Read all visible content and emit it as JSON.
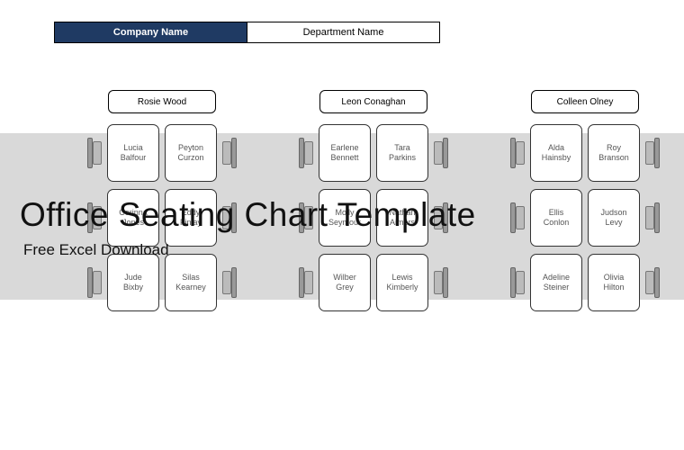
{
  "header": {
    "company": "Company Name",
    "department": "Department Name"
  },
  "overlay": {
    "title": "Office Seating Chart Template",
    "subtitle": "Free Excel Download"
  },
  "clusters": [
    {
      "manager": "Rosie Wood",
      "rows": [
        {
          "left": "Lucia Balfour",
          "right": "Peyton Curzon"
        },
        {
          "left": "Corinna Jones",
          "right": "Eddy Finlay"
        },
        {
          "left": "Jude Bixby",
          "right": "Silas Kearney"
        }
      ]
    },
    {
      "manager": "Leon Conaghan",
      "rows": [
        {
          "left": "Earlene Bennett",
          "right": "Tara Parkins"
        },
        {
          "left": "Molly Seymour",
          "right": "Nathan Aimers"
        },
        {
          "left": "Wilber Grey",
          "right": "Lewis Kimberly"
        }
      ]
    },
    {
      "manager": "Colleen Olney",
      "rows": [
        {
          "left": "Alda Hainsby",
          "right": "Roy Branson"
        },
        {
          "left": "Ellis Conlon",
          "right": "Judson Levy"
        },
        {
          "left": "Adeline Steiner",
          "right": "Olivia Hilton"
        }
      ]
    }
  ]
}
